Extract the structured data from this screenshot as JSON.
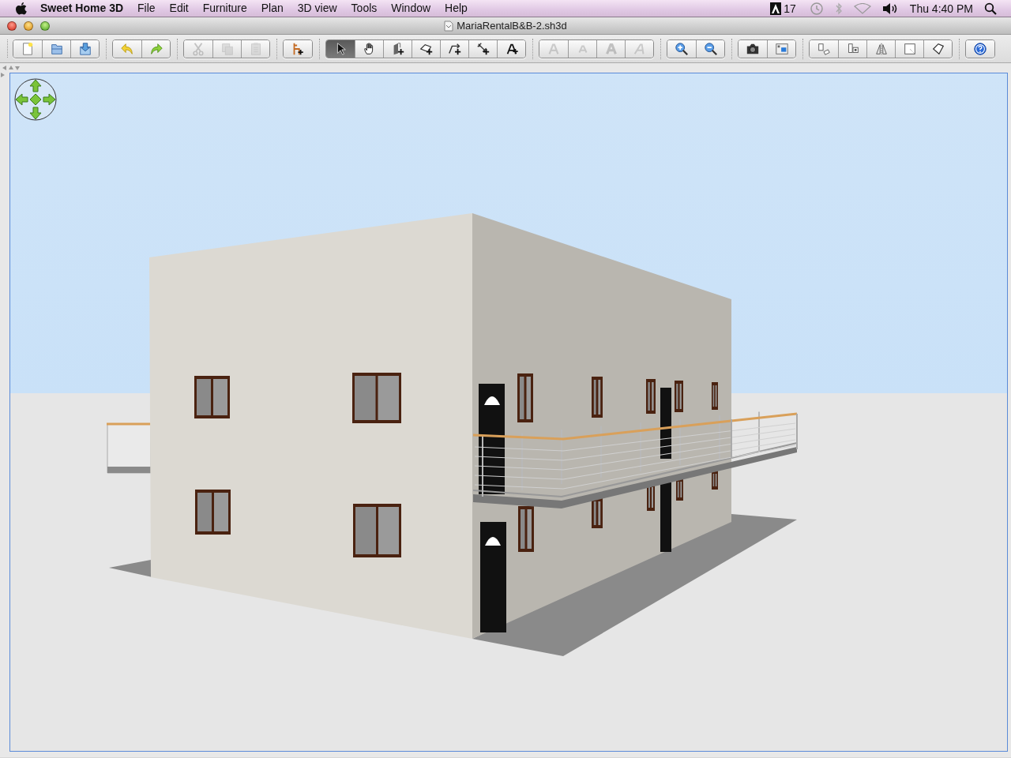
{
  "menu_bar": {
    "app_name": "Sweet Home 3D",
    "menus": [
      "File",
      "Edit",
      "Furniture",
      "Plan",
      "3D view",
      "Tools",
      "Window",
      "Help"
    ],
    "status": {
      "badge_count": "17",
      "clock": "Thu 4:40 PM"
    }
  },
  "window": {
    "title": "MariaRentalB&B-2.sh3d"
  },
  "toolbar": {
    "groups": [
      {
        "buttons": [
          {
            "kind": "new",
            "disabled": false,
            "selected": false
          },
          {
            "kind": "open",
            "disabled": false,
            "selected": false
          },
          {
            "kind": "save",
            "disabled": false,
            "selected": false
          }
        ]
      },
      {
        "buttons": [
          {
            "kind": "undo",
            "disabled": false,
            "selected": false
          },
          {
            "kind": "redo",
            "disabled": false,
            "selected": false
          }
        ]
      },
      {
        "buttons": [
          {
            "kind": "cut",
            "disabled": true,
            "selected": false
          },
          {
            "kind": "copy",
            "disabled": true,
            "selected": false
          },
          {
            "kind": "paste",
            "disabled": true,
            "selected": false
          }
        ]
      },
      {
        "buttons": [
          {
            "kind": "add-furniture",
            "disabled": false,
            "selected": false
          }
        ]
      },
      {
        "buttons": [
          {
            "kind": "select",
            "disabled": false,
            "selected": true
          },
          {
            "kind": "pan",
            "disabled": false,
            "selected": false
          },
          {
            "kind": "walls",
            "disabled": false,
            "selected": false
          },
          {
            "kind": "rooms",
            "disabled": false,
            "selected": false
          },
          {
            "kind": "polylines",
            "disabled": false,
            "selected": false
          },
          {
            "kind": "dimensions",
            "disabled": false,
            "selected": false
          },
          {
            "kind": "text",
            "disabled": false,
            "selected": false
          }
        ]
      },
      {
        "buttons": [
          {
            "kind": "text-larger",
            "disabled": true,
            "selected": false
          },
          {
            "kind": "text-smaller",
            "disabled": true,
            "selected": false
          },
          {
            "kind": "bold",
            "disabled": true,
            "selected": false
          },
          {
            "kind": "italic",
            "disabled": true,
            "selected": false
          }
        ]
      },
      {
        "buttons": [
          {
            "kind": "zoom-in",
            "disabled": false,
            "selected": false
          },
          {
            "kind": "zoom-out",
            "disabled": false,
            "selected": false
          }
        ]
      },
      {
        "buttons": [
          {
            "kind": "photo",
            "disabled": false,
            "selected": false
          },
          {
            "kind": "video",
            "disabled": false,
            "selected": false
          }
        ]
      },
      {
        "buttons": [
          {
            "kind": "rotate",
            "disabled": false,
            "selected": false
          },
          {
            "kind": "stack",
            "disabled": false,
            "selected": false
          },
          {
            "kind": "mirror",
            "disabled": false,
            "selected": false
          },
          {
            "kind": "square",
            "disabled": false,
            "selected": false
          },
          {
            "kind": "polygon",
            "disabled": false,
            "selected": false
          }
        ]
      },
      {
        "buttons": [
          {
            "kind": "help",
            "disabled": false,
            "selected": false
          }
        ]
      }
    ]
  }
}
